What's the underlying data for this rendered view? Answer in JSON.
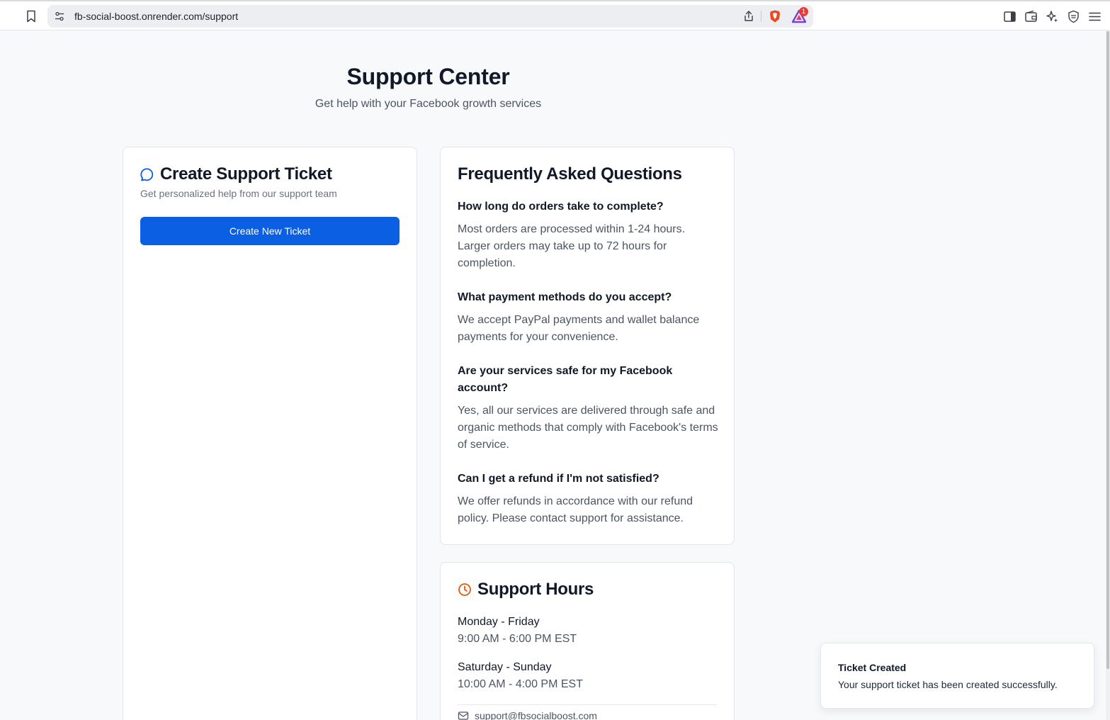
{
  "browser": {
    "url": "fb-social-boost.onrender.com/support",
    "rewards_badge": "1"
  },
  "header": {
    "title": "Support Center",
    "subtitle": "Get help with your Facebook growth services"
  },
  "ticket_card": {
    "title": "Create Support Ticket",
    "description": "Get personalized help from our support team",
    "button_label": "Create New Ticket"
  },
  "faq": {
    "title": "Frequently Asked Questions",
    "items": [
      {
        "q": "How long do orders take to complete?",
        "a": "Most orders are processed within 1-24 hours. Larger orders may take up to 72 hours for completion."
      },
      {
        "q": "What payment methods do you accept?",
        "a": "We accept PayPal payments and wallet balance payments for your convenience."
      },
      {
        "q": "Are your services safe for my Facebook account?",
        "a": "Yes, all our services are delivered through safe and organic methods that comply with Facebook's terms of service."
      },
      {
        "q": "Can I get a refund if I'm not satisfied?",
        "a": "We offer refunds in accordance with our refund policy. Please contact support for assistance."
      }
    ]
  },
  "hours": {
    "title": "Support Hours",
    "weekday_label": "Monday - Friday",
    "weekday_time": "9:00 AM - 6:00 PM EST",
    "weekend_label": "Saturday - Sunday",
    "weekend_time": "10:00 AM - 4:00 PM EST",
    "email": "support@fbsocialboost.com"
  },
  "toast": {
    "title": "Ticket Created",
    "message": "Your support ticket has been created successfully."
  },
  "colors": {
    "primary": "#0b5fe3",
    "clock_accent": "#ea580c",
    "background": "#f8f9fb"
  }
}
